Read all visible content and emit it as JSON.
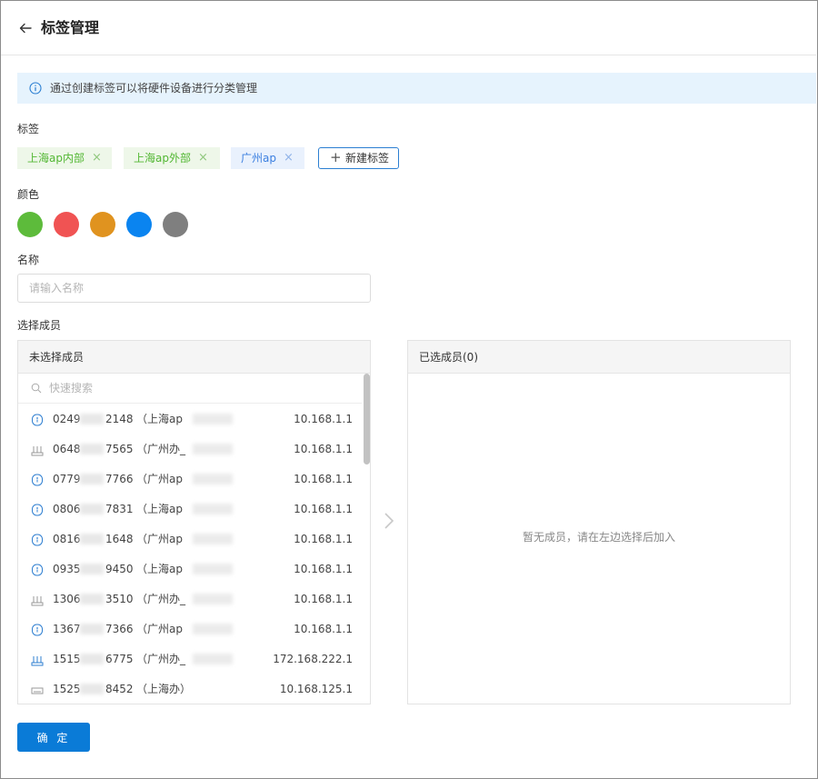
{
  "header": {
    "title": "标签管理"
  },
  "info": {
    "text": "通过创建标签可以将硬件设备进行分类管理"
  },
  "tags_section": {
    "label": "标签",
    "tags": [
      {
        "label": "上海ap内部",
        "close": "×",
        "color": "#52b733"
      },
      {
        "label": "上海ap外部",
        "close": "×",
        "color": "#52b733"
      },
      {
        "label": "广州ap",
        "close": "×",
        "color": "#3b7fe0"
      }
    ],
    "new_tag_label": "新建标签",
    "new_tag_icon": "+"
  },
  "color_section": {
    "label": "颜色",
    "colors": [
      "#5dbb3b",
      "#f05353",
      "#e0931f",
      "#0a84f0",
      "#7f7f7f"
    ]
  },
  "name_section": {
    "label": "名称",
    "placeholder": "请输入名称"
  },
  "members_section": {
    "label": "选择成员",
    "unselected": {
      "title": "未选择成员",
      "search_placeholder": "快速搜索",
      "items": [
        {
          "icon": "ap-icon",
          "prefix": "0249",
          "suffix": "2148",
          "location": "（上海ap",
          "ip": "10.168.1.1"
        },
        {
          "icon": "router-icon",
          "prefix": "0648",
          "suffix": "7565",
          "location": "（广州办_",
          "ip": "10.168.1.1"
        },
        {
          "icon": "ap-icon",
          "prefix": "0779",
          "suffix": "7766",
          "location": "（广州ap",
          "ip": "10.168.1.1"
        },
        {
          "icon": "ap-icon",
          "prefix": "0806",
          "suffix": "7831",
          "location": "（上海ap",
          "ip": "10.168.1.1"
        },
        {
          "icon": "ap-icon",
          "prefix": "0816",
          "suffix": "1648",
          "location": "（广州ap",
          "ip": "10.168.1.1"
        },
        {
          "icon": "ap-icon",
          "prefix": "0935",
          "suffix": "9450",
          "location": "（上海ap",
          "ip": "10.168.1.1"
        },
        {
          "icon": "router-icon",
          "prefix": "1306",
          "suffix": "3510",
          "location": "（广州办_",
          "ip": "10.168.1.1"
        },
        {
          "icon": "ap-icon",
          "prefix": "1367",
          "suffix": "7366",
          "location": "（广州ap",
          "ip": "10.168.1.1"
        },
        {
          "icon": "router-icon-blue",
          "prefix": "1515",
          "suffix": "6775",
          "location": "（广州办_",
          "ip": "172.168.222.1"
        },
        {
          "icon": "switch-icon",
          "prefix": "1525",
          "suffix": "8452",
          "location": "（上海办）",
          "ip": "10.168.125.1"
        }
      ]
    },
    "selected": {
      "title": "已选成员(0)",
      "empty_text": "暂无成员，请在左边选择后加入"
    }
  },
  "confirm_label": "确 定"
}
